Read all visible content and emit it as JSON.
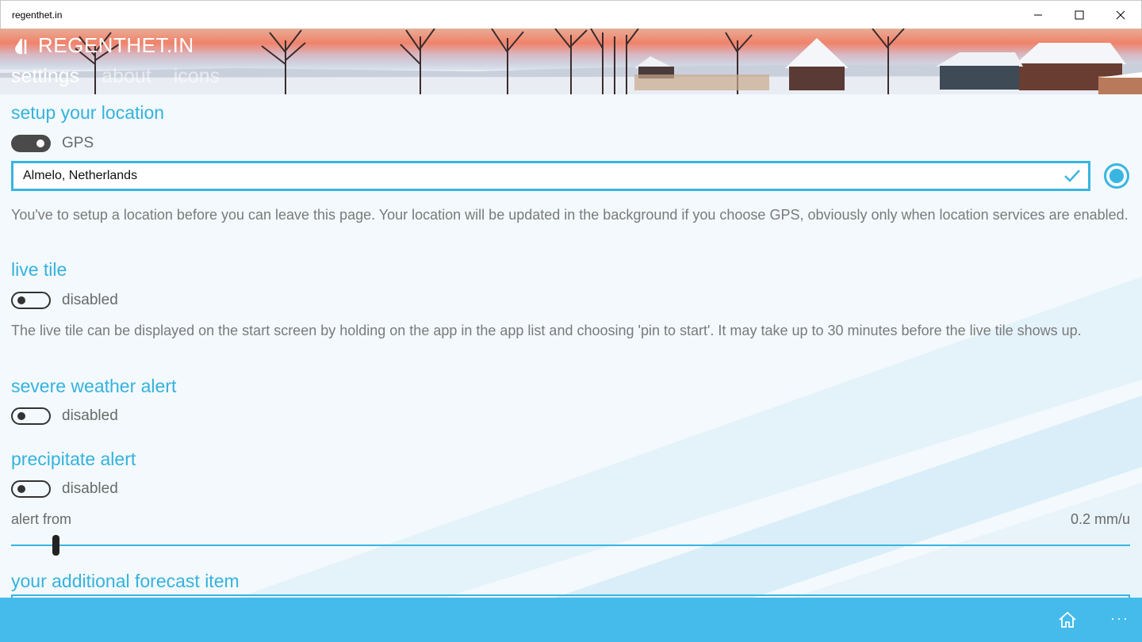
{
  "window": {
    "title": "regenthet.in"
  },
  "header": {
    "brand": "REGENTHET.IN",
    "tabs": [
      {
        "label": "settings",
        "active": true
      },
      {
        "label": "about",
        "active": false
      },
      {
        "label": "icons",
        "active": false
      }
    ]
  },
  "location": {
    "heading": "setup your location",
    "gps_toggle": {
      "label": "GPS",
      "on": true
    },
    "input_value": "Almelo, Netherlands",
    "description": "You've to setup a location before you can leave this page. Your location will be updated in the background if you choose GPS, obviously only when location services are enabled."
  },
  "live_tile": {
    "heading": "live tile",
    "toggle": {
      "label": "disabled",
      "on": false
    },
    "description": "The live tile can be displayed on the start screen by holding on the app in the app list and choosing 'pin to start'. It may take up to 30 minutes before the live tile shows up."
  },
  "severe_weather": {
    "heading": "severe weather alert",
    "toggle": {
      "label": "disabled",
      "on": false
    }
  },
  "precipitate": {
    "heading": "precipitate alert",
    "toggle": {
      "label": "disabled",
      "on": false
    },
    "slider": {
      "label": "alert from",
      "value_text": "0.2 mm/u",
      "fraction": 0.02
    }
  },
  "forecast": {
    "heading": "your additional forecast item"
  },
  "appbar": {
    "home_icon": "home-icon",
    "more_icon": "more-icon",
    "more_label": "···"
  },
  "colors": {
    "accent": "#39b5e1",
    "appbar": "#44bbeb",
    "heading": "#35b2de"
  }
}
